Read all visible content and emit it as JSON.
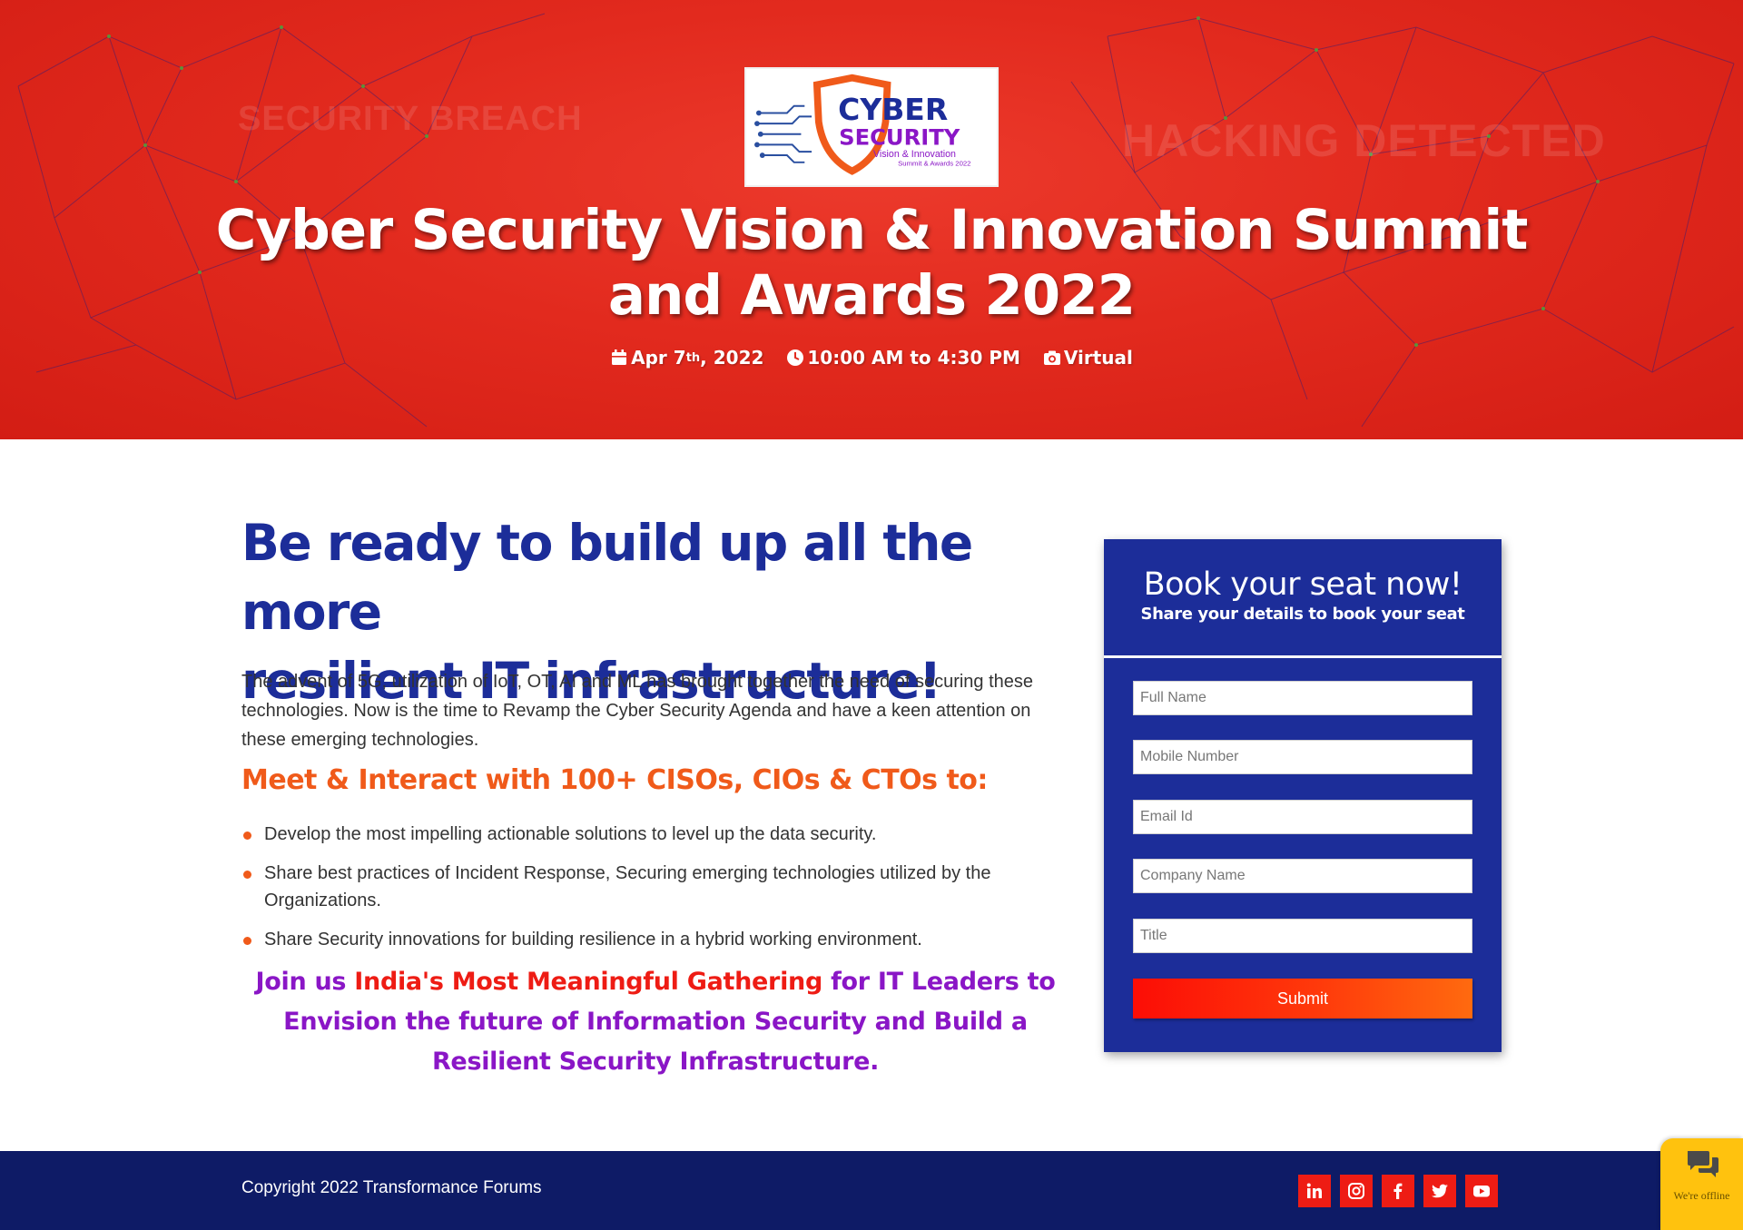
{
  "hero": {
    "logo": {
      "line1": "CYBER",
      "line2": "SECURITY",
      "line3": "Vision & Innovation",
      "line4": "Summit & Awards 2022"
    },
    "ghost_left": "SECURITY BREACH",
    "ghost_right": "HACKING DETECTED",
    "title_line1": "Cyber Security Vision & Innovation Summit",
    "title_line2": "and Awards 2022",
    "date_prefix": "Apr 7",
    "date_sup": "th",
    "date_suffix": ", 2022",
    "time": "10:00 AM to 4:30 PM",
    "mode": "Virtual"
  },
  "main": {
    "headline_line1": "Be ready to build up all the more",
    "headline_line2": "resilient IT infrastructure!",
    "intro": "The advent of 5G, utilization of IoT, OT, AI and ML has brought together the need of securing these technologies. Now is the time to Revamp the Cyber Security Agenda and have a keen attention on these emerging technologies.",
    "meet_heading": "Meet & Interact with 100+ CISOs, CIOs & CTOs to:",
    "bullets": [
      "Develop the most impelling actionable solutions to level up the data security.",
      "Share best practices of Incident Response, Securing emerging technologies utilized by the Organizations.",
      "Share Security innovations for building resilience in a hybrid working environment."
    ],
    "join_prefix": "Join us ",
    "join_highlight": "India's Most Meaningful Gathering",
    "join_suffix": " for IT Leaders to Envision the future of Information Security and Build a Resilient Security Infrastructure."
  },
  "form": {
    "title": "Book your seat now!",
    "subtitle": "Share your details to book your seat",
    "fields": {
      "full_name": "Full Name",
      "mobile": "Mobile Number",
      "email": "Email Id",
      "company": "Company Name",
      "title": "Title"
    },
    "submit_label": "Submit"
  },
  "footer": {
    "copyright": "Copyright 2022 Transformance Forums",
    "social": [
      "linkedin-icon",
      "instagram-icon",
      "facebook-icon",
      "twitter-icon",
      "youtube-icon"
    ]
  },
  "chat": {
    "status": "We're offline"
  },
  "colors": {
    "hero_red": "#e22a1e",
    "brand_blue": "#1c2d99",
    "footer_navy": "#0e1b66",
    "accent_orange": "#f05a1a",
    "purple": "#8a16c6",
    "highlight_red": "#ee1c14",
    "chat_yellow": "#ffc20e"
  }
}
